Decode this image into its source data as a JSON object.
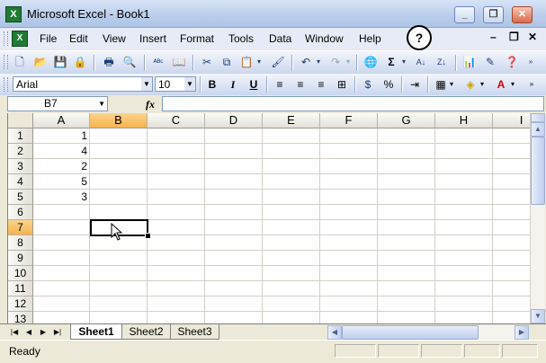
{
  "window": {
    "title": "Microsoft Excel - Book1",
    "app_icon": "X"
  },
  "menu": [
    "File",
    "Edit",
    "View",
    "Insert",
    "Format",
    "Tools",
    "Data",
    "Window",
    "Help"
  ],
  "formatting": {
    "font": "Arial",
    "size": "10",
    "bold_label": "B",
    "italic_label": "I",
    "underline_label": "U"
  },
  "formula_bar": {
    "name_box": "B7",
    "fx_label": "fx",
    "content": ""
  },
  "grid": {
    "columns": [
      "A",
      "B",
      "C",
      "D",
      "E",
      "F",
      "G",
      "H",
      "I"
    ],
    "rows": [
      "1",
      "2",
      "3",
      "4",
      "5",
      "6",
      "7",
      "8",
      "9",
      "10",
      "11",
      "12",
      "13"
    ],
    "cells": {
      "A1": "1",
      "A2": "4",
      "A3": "2",
      "A4": "5",
      "A5": "3"
    },
    "selected_col": "B",
    "selected_row": "7"
  },
  "sheets": [
    {
      "name": "Sheet1",
      "active": true
    },
    {
      "name": "Sheet2",
      "active": false
    },
    {
      "name": "Sheet3",
      "active": false
    }
  ],
  "status": {
    "text": "Ready"
  },
  "colors": {
    "selection_header": "#f5b34c",
    "title_gradient": "#b9cdea"
  }
}
